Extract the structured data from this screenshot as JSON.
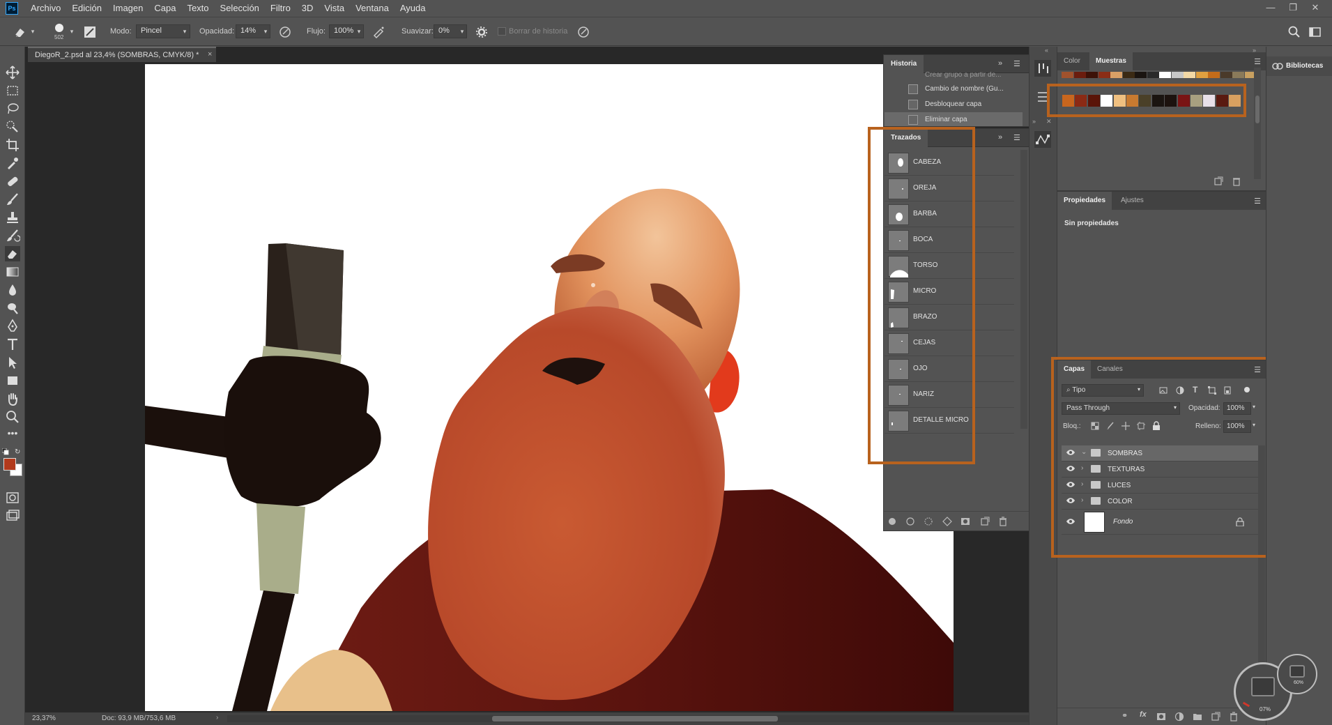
{
  "menu": {
    "app_icon": "Ps",
    "items": [
      "Archivo",
      "Edición",
      "Imagen",
      "Capa",
      "Texto",
      "Selección",
      "Filtro",
      "3D",
      "Vista",
      "Ventana",
      "Ayuda"
    ]
  },
  "options": {
    "brush_size": "502",
    "mode_label": "Modo:",
    "mode_value": "Pincel",
    "opacity_label": "Opacidad:",
    "opacity_value": "14%",
    "flow_label": "Flujo:",
    "flow_value": "100%",
    "smooth_label": "Suavizar:",
    "smooth_value": "0%",
    "erase_history_label": "Borrar de historia"
  },
  "document": {
    "tab_title": "DiegoR_2.psd al 23,4% (SOMBRAS, CMYK/8) *",
    "tab_close": "×",
    "zoom": "23,37%",
    "doc_info": "Doc: 93,9 MB/753,6 MB"
  },
  "history_panel": {
    "title": "Historia",
    "items": [
      "Crear grupo a partir de...",
      "Cambio de nombre (Gu...",
      "Desbloquear capa",
      "Eliminar capa"
    ]
  },
  "paths_panel": {
    "title": "Trazados",
    "items": [
      "CABEZA",
      "OREJA",
      "BARBA",
      "BOCA",
      "TORSO",
      "MICRO",
      "BRAZO",
      "CEJAS",
      "OJO",
      "NARIZ",
      "DETALLE MICRO"
    ]
  },
  "color_panel": {
    "tabs": [
      "Color",
      "Muestras"
    ],
    "active_tab": "Muestras",
    "top_swatches": [
      "#a0522d",
      "#6b1d0e",
      "#3d1208",
      "#8b2d16",
      "#d9a066",
      "#3b2a14",
      "#1a1410",
      "#2a2a2a",
      "#ffffff",
      "#c8c8c8",
      "#f3d9a6",
      "#e0a040",
      "#c46c1a",
      "#4a3a2a",
      "#8a7a5a",
      "#c8a060"
    ],
    "main_swatches": [
      "#c8661e",
      "#8b2a14",
      "#5a1408",
      "#ffffff",
      "#f0c080",
      "#c87a30",
      "#4a4028",
      "#1a1410",
      "#1c120e",
      "#7a1414",
      "#a8a080",
      "#e8e0e8",
      "#5a1a10",
      "#d8a060"
    ]
  },
  "properties_panel": {
    "tabs": [
      "Propiedades",
      "Ajustes"
    ],
    "active_tab": "Propiedades",
    "content": "Sin propiedades"
  },
  "layers_panel": {
    "tabs": [
      "Capas",
      "Canales"
    ],
    "active_tab": "Capas",
    "filter_kind": "Tipo",
    "blend_mode": "Pass Through",
    "opacity_label": "Opacidad:",
    "opacity_value": "100%",
    "lock_label": "Bloq.:",
    "fill_label": "Relleno:",
    "fill_value": "100%",
    "layers": [
      {
        "name": "SOMBRAS",
        "type": "group",
        "selected": true
      },
      {
        "name": "TEXTURAS",
        "type": "group",
        "selected": false
      },
      {
        "name": "LUCES",
        "type": "group",
        "selected": false
      },
      {
        "name": "COLOR",
        "type": "group",
        "selected": false
      },
      {
        "name": "Fondo",
        "type": "background",
        "selected": false
      }
    ]
  },
  "libraries_panel": {
    "title": "Bibliotecas"
  },
  "gauges": {
    "left_value": "07%",
    "right_value": "60%"
  },
  "colors": {
    "foreground": "#b23a1c",
    "background": "#ffffff",
    "highlight_frame": "#b8621e"
  }
}
